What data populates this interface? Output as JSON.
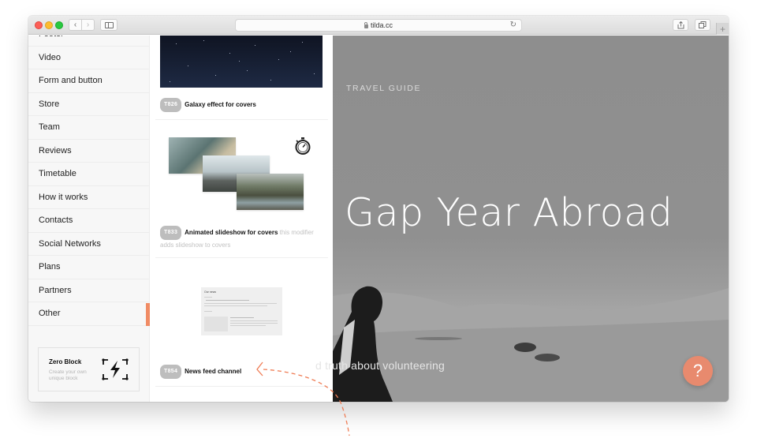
{
  "browser": {
    "url": "tilda.cc",
    "back_label": "‹",
    "forward_label": "›",
    "reload_label": "↻",
    "new_tab_label": "+"
  },
  "categories": {
    "items": [
      {
        "label": "Footer"
      },
      {
        "label": "Video"
      },
      {
        "label": "Form and button"
      },
      {
        "label": "Store"
      },
      {
        "label": "Team"
      },
      {
        "label": "Reviews"
      },
      {
        "label": "Timetable"
      },
      {
        "label": "How it works"
      },
      {
        "label": "Contacts"
      },
      {
        "label": "Social Networks"
      },
      {
        "label": "Plans"
      },
      {
        "label": "Partners"
      },
      {
        "label": "Other"
      }
    ],
    "active": "Other",
    "accent_color": "#f08b64",
    "zero_block": {
      "title": "Zero Block",
      "subtitle": "Create your own unique block"
    }
  },
  "blocks": [
    {
      "code": "T826",
      "title": "Galaxy effect for covers",
      "description": ""
    },
    {
      "code": "T833",
      "title": "Animated slideshow for covers",
      "description": "this modifier adds slideshow to covers"
    },
    {
      "code": "T854",
      "title": "News feed channel",
      "description": "",
      "thumb_heading": "Our news"
    }
  ],
  "hero": {
    "eyebrow": "TRAVEL GUIDE",
    "title": "Gap Year Abroad",
    "subtitle": "The hard truth about volunteering",
    "subtitle_visible": "d truth about volunteering",
    "help_label": "?",
    "help_color": "#e88a6e"
  }
}
